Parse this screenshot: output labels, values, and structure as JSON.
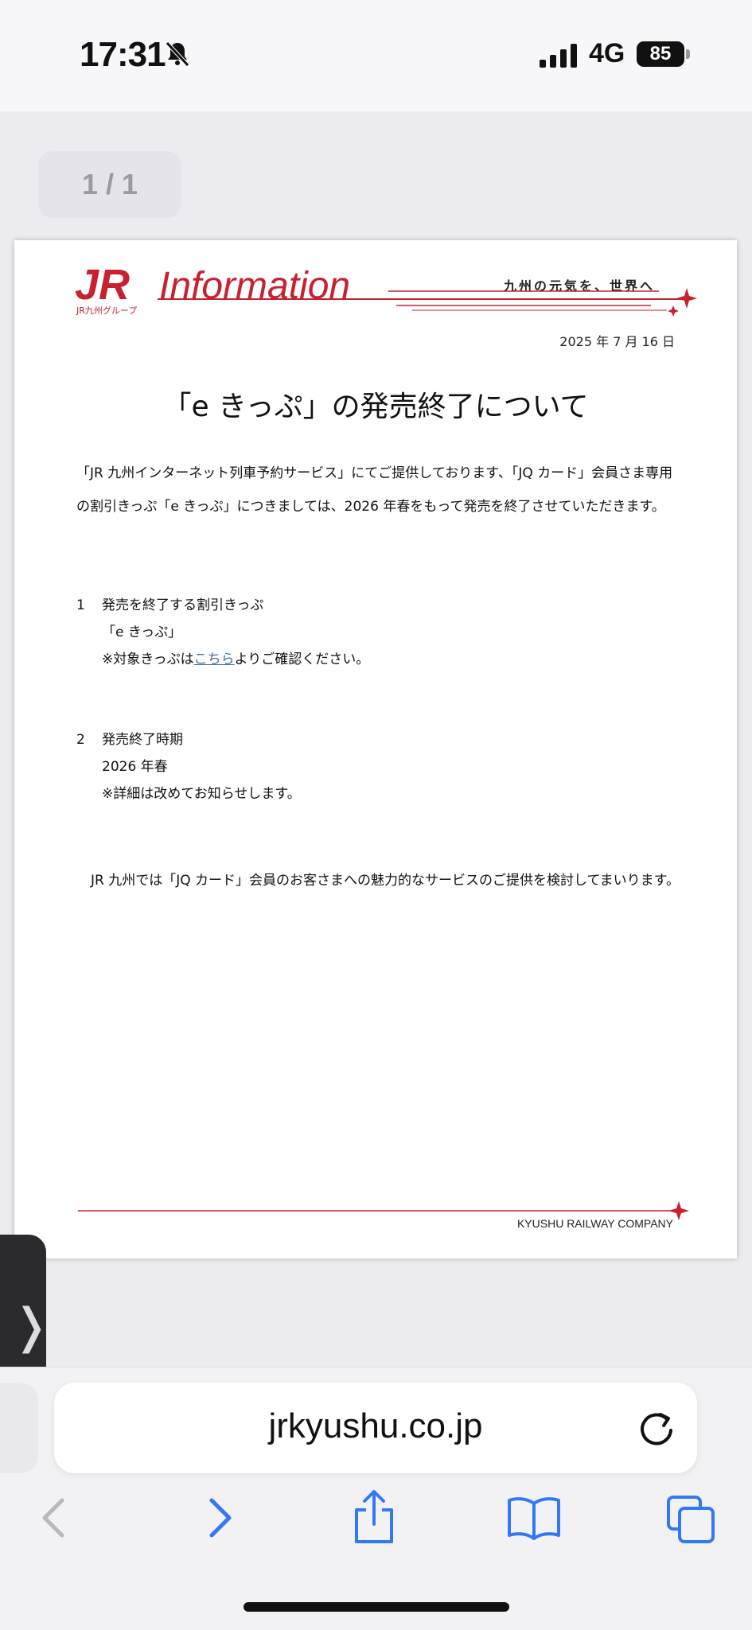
{
  "status_bar": {
    "time": "17:31",
    "network": "4G",
    "battery": "85"
  },
  "pdf": {
    "page_indicator": "1 / 1"
  },
  "document": {
    "logo_text": "JR九州グループ",
    "header_title": "Information",
    "slogan": "九州の元気を、世界へ",
    "date": "2025 年 7 月 16 日",
    "title": "「e きっぷ」の発売終了について",
    "intro_line1": "「JR 九州インターネット列車予約サービス」にてご提供しております、「JQ カード」会員さま専用",
    "intro_line2": "の割引きっぷ「e きっぷ」につきましては、2026 年春をもって発売を終了させていただきます。",
    "section1": {
      "number": "1",
      "heading": "発売を終了する割引きっぷ",
      "item": "「e きっぷ」",
      "note_prefix": "※対象きっぷは",
      "note_link": "こちら",
      "note_suffix": "よりご確認ください。"
    },
    "section2": {
      "number": "2",
      "heading": "発売終了時期",
      "item": "2026 年春",
      "note": "※詳細は改めてお知らせします。"
    },
    "closing": "JR 九州では「JQ カード」会員のお客さまへの魅力的なサービスのご提供を検討してまいります。",
    "footer_company": "KYUSHU RAILWAY COMPANY"
  },
  "browser": {
    "url": "jrkyushu.co.jp",
    "icons": [
      "back-icon",
      "forward-icon",
      "share-icon",
      "bookmarks-icon",
      "tabs-icon",
      "reload-icon"
    ]
  },
  "colors": {
    "brand_red": "#c8202e",
    "link_blue": "#3a6fb3",
    "ios_blue": "#3478f6"
  }
}
